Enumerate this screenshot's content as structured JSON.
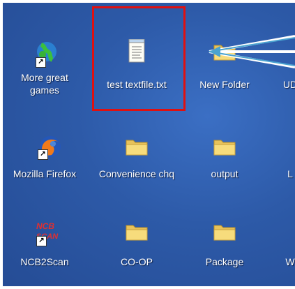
{
  "desktop": {
    "icons": [
      {
        "label": "More great games",
        "icon": "globe-icon"
      },
      {
        "label": "test textfile.txt",
        "icon": "notepad-file-icon"
      },
      {
        "label": "New Folder",
        "icon": "folder-icon"
      },
      {
        "label": "UD",
        "icon": "folder-icon"
      },
      {
        "label": "Mozilla Firefox",
        "icon": "firefox-icon"
      },
      {
        "label": "Convenience chq",
        "icon": "folder-icon"
      },
      {
        "label": "output",
        "icon": "folder-icon"
      },
      {
        "label": "L",
        "icon": "folder-icon"
      },
      {
        "label": "NCB2Scan",
        "icon": "ncb-scan-icon"
      },
      {
        "label": "CO-OP",
        "icon": "folder-icon"
      },
      {
        "label": "Package",
        "icon": "folder-icon"
      },
      {
        "label": "W",
        "icon": "folder-icon"
      }
    ],
    "highlight_color": "#e01010",
    "arrow_color": "#4aa3d0"
  }
}
